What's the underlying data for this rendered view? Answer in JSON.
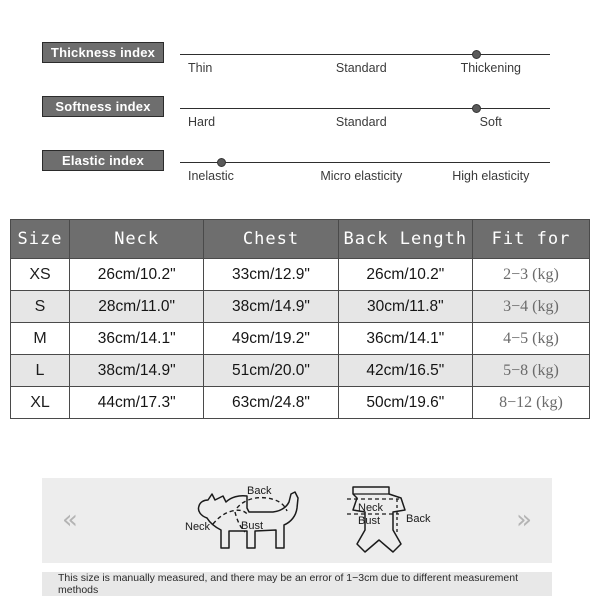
{
  "indices": [
    {
      "label": "Thickness index",
      "ticks": [
        "Thin",
        "Standard",
        "Thickening"
      ],
      "selected": "Thickening",
      "dot_percent": 79
    },
    {
      "label": "Softness index",
      "ticks": [
        "Hard",
        "Standard",
        "Soft"
      ],
      "selected": "Soft",
      "dot_percent": 79
    },
    {
      "label": "Elastic index",
      "ticks": [
        "Inelastic",
        "Micro elasticity",
        "High elasticity"
      ],
      "selected": "Inelastic",
      "dot_percent": 10
    }
  ],
  "table": {
    "headers": [
      "Size",
      "Neck",
      "Chest",
      "Back Length",
      "Fit for"
    ],
    "rows": [
      {
        "size": "XS",
        "neck": "26cm/10.2\"",
        "chest": "33cm/12.9\"",
        "back": "26cm/10.2\"",
        "fit": "2−3 (kg)"
      },
      {
        "size": "S",
        "neck": "28cm/11.0\"",
        "chest": "38cm/14.9\"",
        "back": "30cm/11.8\"",
        "fit": "3−4 (kg)"
      },
      {
        "size": "M",
        "neck": "36cm/14.1\"",
        "chest": "49cm/19.2\"",
        "back": "36cm/14.1\"",
        "fit": "4−5 (kg)"
      },
      {
        "size": "L",
        "neck": "38cm/14.9\"",
        "chest": "51cm/20.0\"",
        "back": "42cm/16.5\"",
        "fit": "5−8 (kg)"
      },
      {
        "size": "XL",
        "neck": "44cm/17.3\"",
        "chest": "63cm/24.8\"",
        "back": "50cm/19.6\"",
        "fit": "8−12 (kg)"
      }
    ]
  },
  "illustration": {
    "prev_arrow": "«",
    "next_arrow": "»",
    "dog": {
      "neck": "Neck",
      "bust": "Bust",
      "back": "Back"
    },
    "garment": {
      "neck": "Neck",
      "bust": "Bust",
      "back": "Back"
    }
  },
  "footer": {
    "note": "This size is manually measured, and there may be an error of 1−3cm due to different measurement methods"
  },
  "colors": {
    "badge_bg": "#6e6e6e",
    "header_bg": "#6e6e6e",
    "alt_row_bg": "#e6e6e6",
    "panel_bg": "#ededed",
    "footer_bg": "#e8e8e8"
  }
}
